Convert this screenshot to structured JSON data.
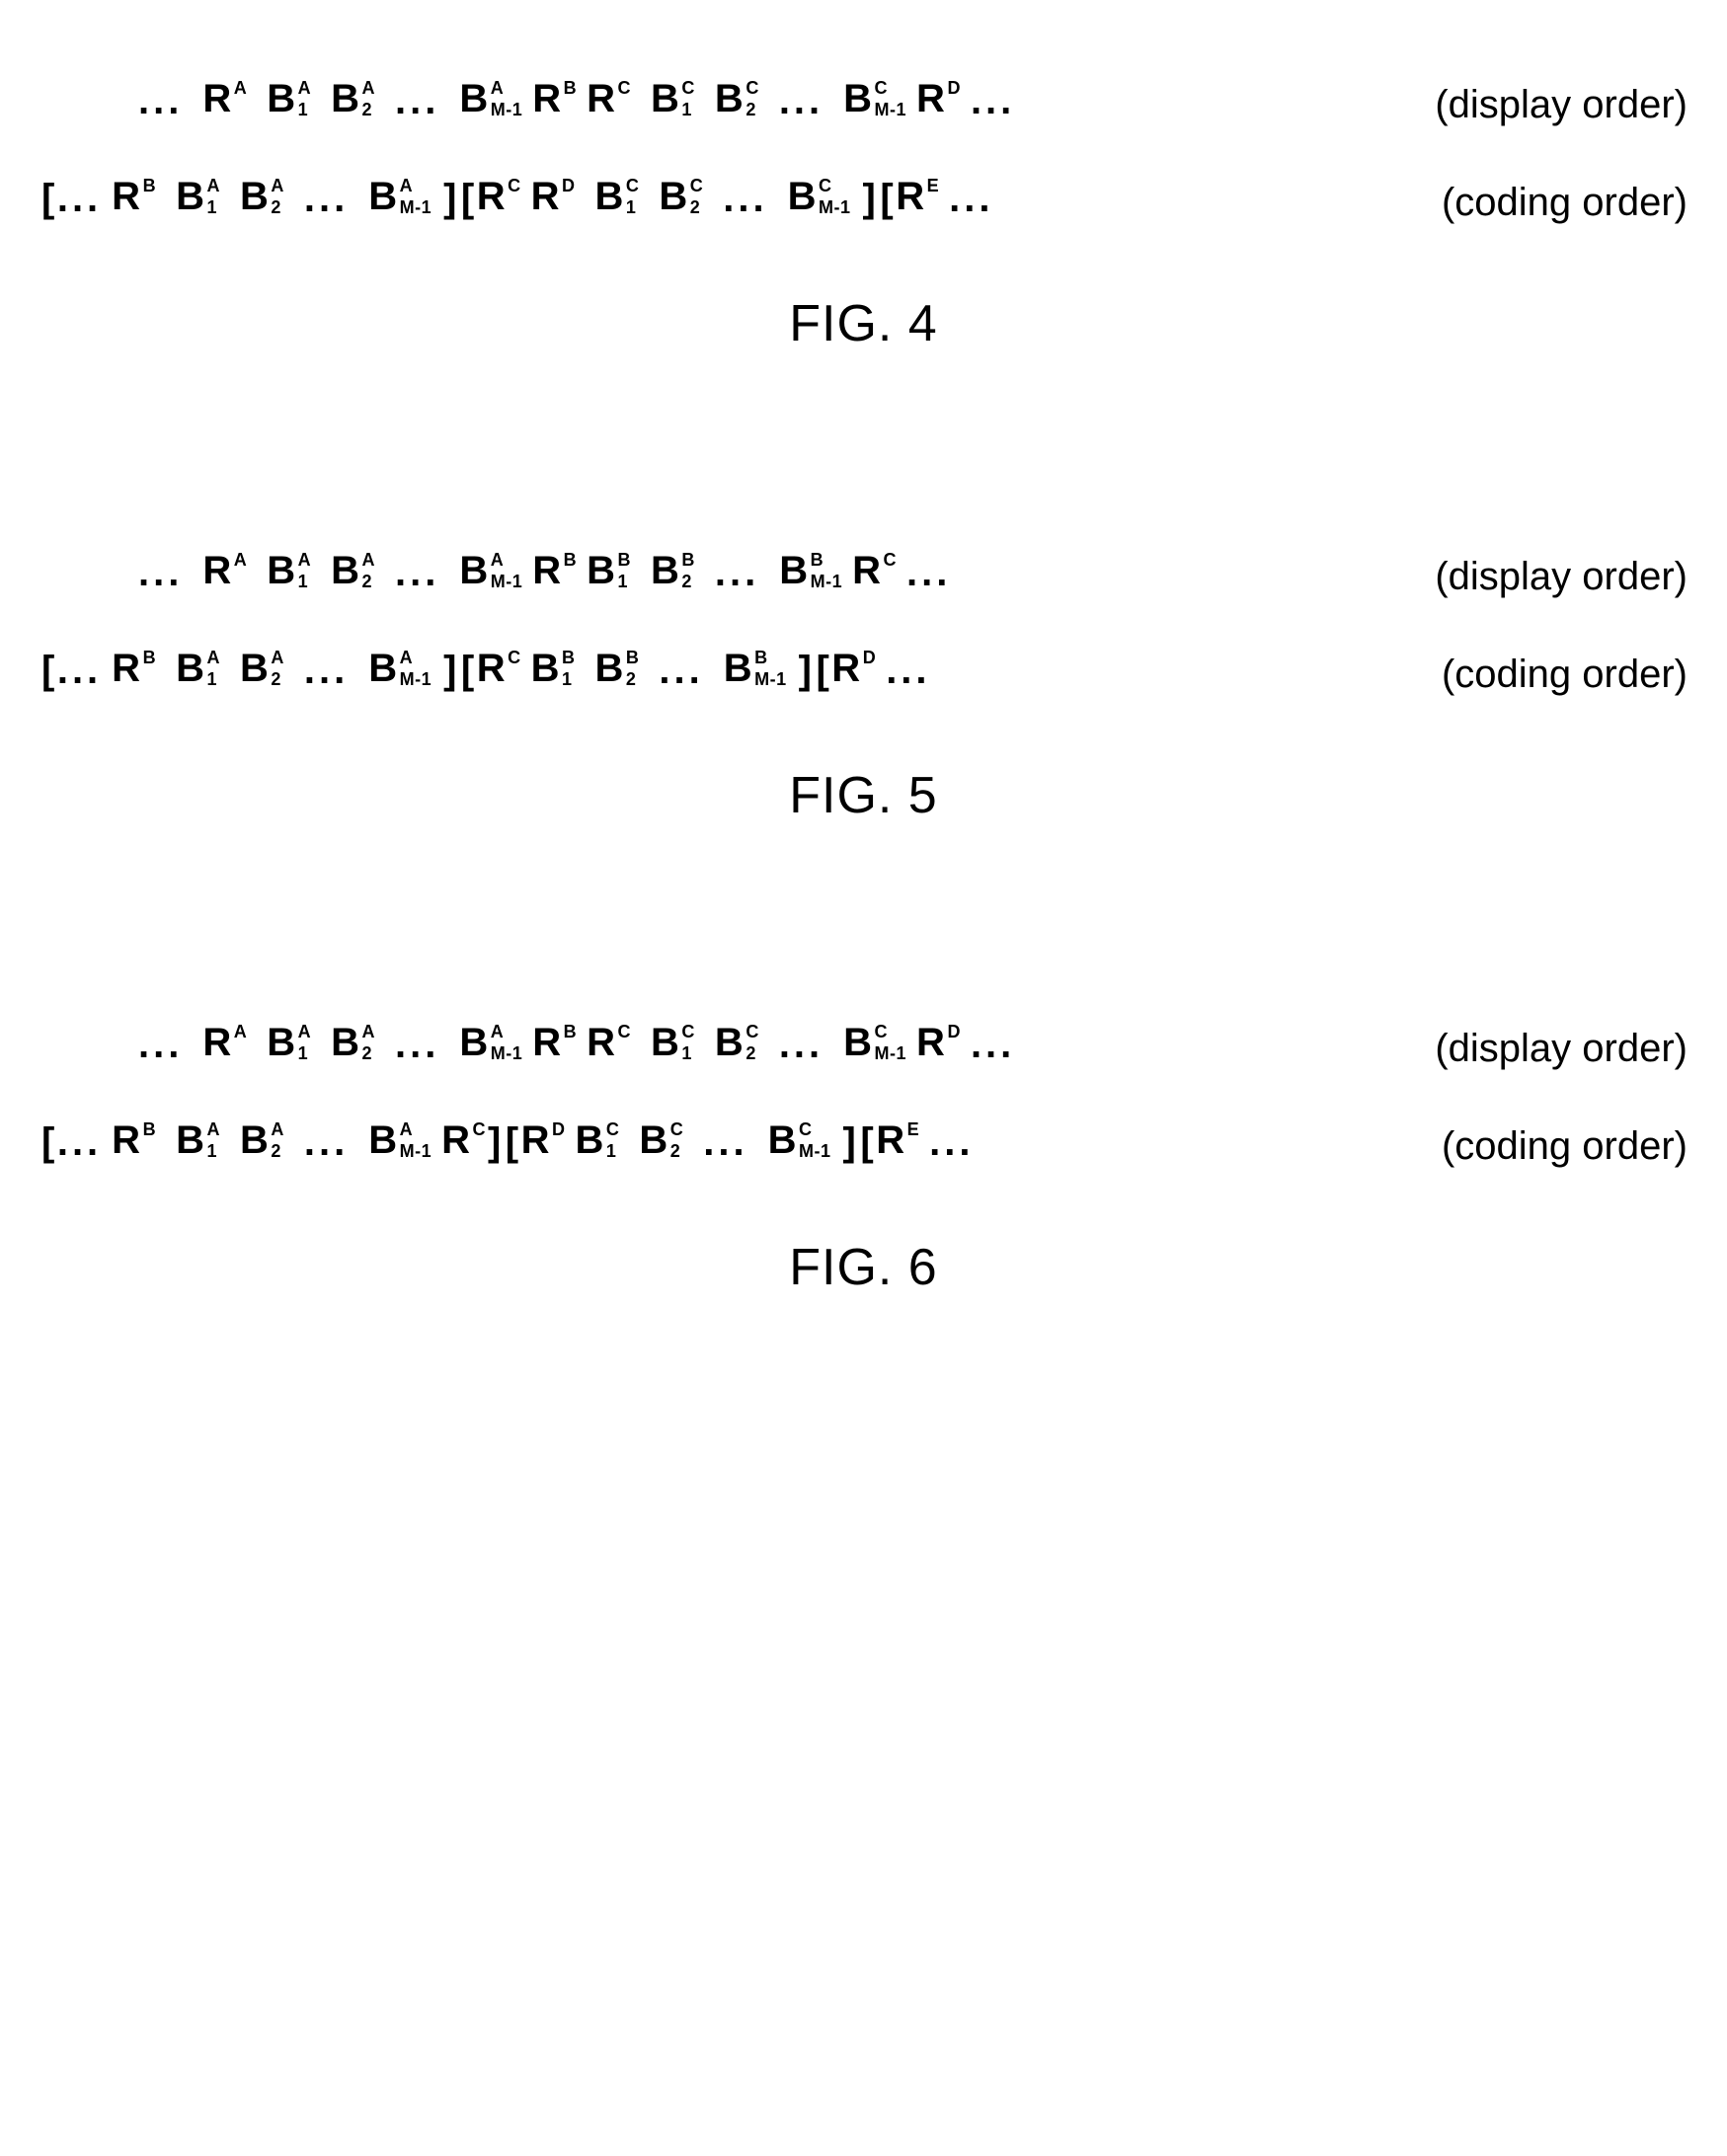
{
  "labels": {
    "display": "(display order)",
    "coding": "(coding order)"
  },
  "captions": {
    "fig4": "FIG. 4",
    "fig5": "FIG. 5",
    "fig6": "FIG. 6"
  },
  "sym": {
    "dots": "...",
    "lb": "[",
    "rb": "]",
    "R": "R",
    "B": "B",
    "supA": "A",
    "supB": "B",
    "supC": "C",
    "supD": "D",
    "supE": "E",
    "sub1": "1",
    "sub2": "2",
    "subM1": "M-1"
  },
  "chart_data": [
    {
      "figure": "FIG. 4",
      "type": "sequence-diagram",
      "display_order": "...R^A B^A_1 B^A_2 ... B^A_{M-1} R^B R^C B^C_1 B^C_2 ... B^C_{M-1} R^D ...",
      "coding_order": "[...R^B B^A_1 B^A_2 ... B^A_{M-1}][R^C R^D B^C_1 B^C_2 ... B^C_{M-1}][R^E ..."
    },
    {
      "figure": "FIG. 5",
      "type": "sequence-diagram",
      "display_order": "...R^A B^A_1 B^A_2 ... B^A_{M-1} R^B B^B_1 B^B_2 ... B^B_{M-1} R^C ...",
      "coding_order": "[...R^B B^A_1 B^A_2 ... B^A_{M-1}][R^C B^B_1 B^B_2 ... B^B_{M-1}][R^D ..."
    },
    {
      "figure": "FIG. 6",
      "type": "sequence-diagram",
      "display_order": "...R^A B^A_1 B^A_2 ... B^A_{M-1} R^B R^C B^C_1 B^C_2 ... B^C_{M-1} R^D ...",
      "coding_order": "[...R^B B^A_1 B^A_2 ... B^A_{M-1} R^C ][R^D B^C_1 B^C_2 ... B^C_{M-1}][R^E ..."
    }
  ]
}
